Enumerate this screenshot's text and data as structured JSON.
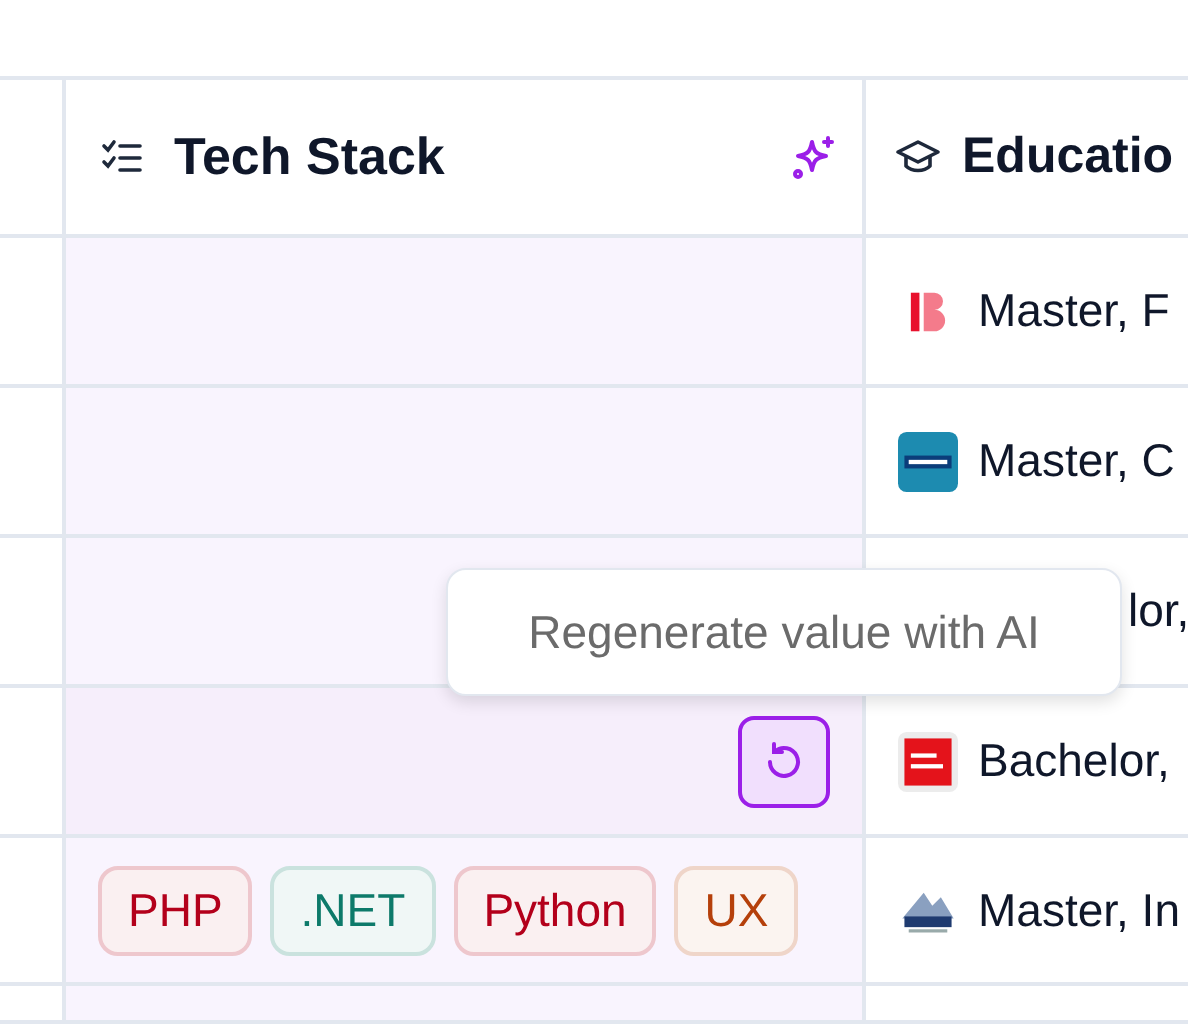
{
  "header": [
    {
      "kind": "blank"
    },
    {
      "kind": "tech",
      "label": "Tech Stack",
      "ai_enabled": true
    },
    {
      "kind": "education",
      "label": "Educatio"
    }
  ],
  "rows": [
    {
      "hovered": false,
      "education": {
        "kind": "full",
        "logo": {
          "kind": "b"
        },
        "text": "Master, F"
      }
    },
    {
      "hovered": false,
      "education": {
        "kind": "full",
        "logo": {
          "kind": "ku"
        },
        "text": "Master, C"
      }
    },
    {
      "hovered": false,
      "education": {
        "kind": "partial",
        "text": "lor,"
      }
    },
    {
      "hovered": true,
      "tooltip": "Regenerate value with AI",
      "education": {
        "kind": "full",
        "logo": {
          "kind": "uwe"
        },
        "text": "Bachelor,"
      }
    },
    {
      "hovered": false,
      "tech": [
        {
          "label": "PHP",
          "color": "#b3001b"
        },
        {
          "label": ".NET",
          "color": "#0d7a6a"
        },
        {
          "label": "Python",
          "color": "#b3001b"
        },
        {
          "label": "UX",
          "color": "#b5400b"
        }
      ],
      "education": {
        "kind": "full",
        "logo": {
          "kind": "ecam"
        },
        "text": "Master, In"
      }
    },
    {
      "hovered": false
    }
  ]
}
